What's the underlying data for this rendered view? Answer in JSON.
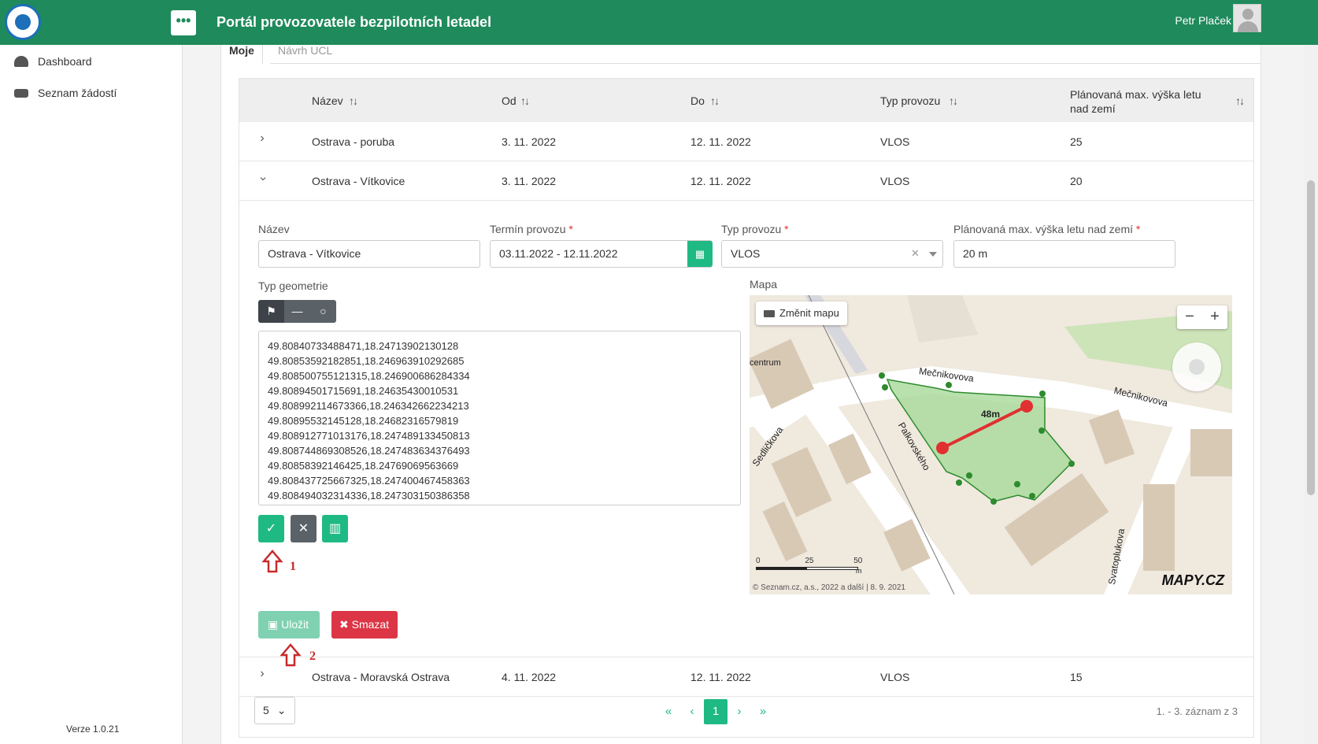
{
  "header": {
    "title": "Portál provozovatele bezpilotních letadel",
    "user": "Petr Plaček",
    "menu_label": "•••"
  },
  "sidebar": {
    "items": [
      {
        "label": "Dashboard",
        "icon": "dashboard-icon"
      },
      {
        "label": "Seznam žádostí",
        "icon": "inbox-icon"
      }
    ],
    "version": "Verze 1.0.21"
  },
  "tabs": [
    {
      "label": "Moje",
      "active": true
    },
    {
      "label": "Návrh UCL",
      "active": false
    }
  ],
  "table": {
    "columns": [
      "Název",
      "Od",
      "Do",
      "Typ provozu",
      "Plánovaná max. výška letu nad zemí"
    ],
    "rows": [
      {
        "name": "Ostrava - poruba",
        "from": "3. 11. 2022",
        "to": "12. 11. 2022",
        "type": "VLOS",
        "height": "25",
        "expanded": false
      },
      {
        "name": "Ostrava - Vítkovice",
        "from": "3. 11. 2022",
        "to": "12. 11. 2022",
        "type": "VLOS",
        "height": "20",
        "expanded": true
      },
      {
        "name": "Ostrava - Moravská Ostrava",
        "from": "4. 11. 2022",
        "to": "12. 11. 2022",
        "type": "VLOS",
        "height": "15",
        "expanded": false
      }
    ]
  },
  "form": {
    "name_label": "Název",
    "name_value": "Ostrava - Vítkovice",
    "term_label": "Termín provozu",
    "term_value": "03.11.2022 - 12.11.2022",
    "type_label": "Typ provozu",
    "type_value": "VLOS",
    "height_label": "Plánovaná max. výška letu nad zemí",
    "height_value": "20 m",
    "required_mark": "*",
    "geometry_label": "Typ geometrie",
    "map_label": "Mapa",
    "coordinates": [
      "49.80840733488471,18.24713902130128",
      "49.80853592182851,18.246963910292685",
      "49.808500755121315,18.246900686284334",
      "49.80894501715691,18.24635430010531",
      "49.8089921146733​66,18.246342662234213",
      "49.80895532145128,18.24682316579819",
      "49.808912771013176,18.247489133450813",
      "49.808744869308526,18.247483634376493",
      "49.80858392146425,18.24769069563669",
      "49.808437725667325,18.247400467458363",
      "49.808494032314336,18.247303150386358"
    ],
    "save_label": "Uložit",
    "delete_label": "Smazat",
    "annotation_1": "1",
    "annotation_2": "2"
  },
  "map": {
    "change_map_label": "Změnit mapu",
    "distance_label": "48m",
    "street_labels": [
      "Mečnikovova",
      "Mečnikovova",
      "Palkovského",
      "Sedličkova",
      "Svatoplukova",
      "centrum"
    ],
    "scale_labels": [
      "0",
      "25",
      "50",
      "m"
    ],
    "copyright": "© Seznam.cz, a.s., 2022 a další | 8. 9. 2021",
    "logo": "MAPY.CZ",
    "colors": {
      "polygon_fill": "#a8d99a",
      "polygon_stroke": "#2e8b2e",
      "measure_line": "#e03030"
    }
  },
  "pagination": {
    "page_size": "5",
    "first": "«",
    "prev": "‹",
    "current": "1",
    "next": "›",
    "last": "»",
    "info": "1. - 3. záznam z 3"
  },
  "colors": {
    "header_bg": "#1f8a5b",
    "accent": "#1fb984",
    "danger": "#dc3545"
  }
}
